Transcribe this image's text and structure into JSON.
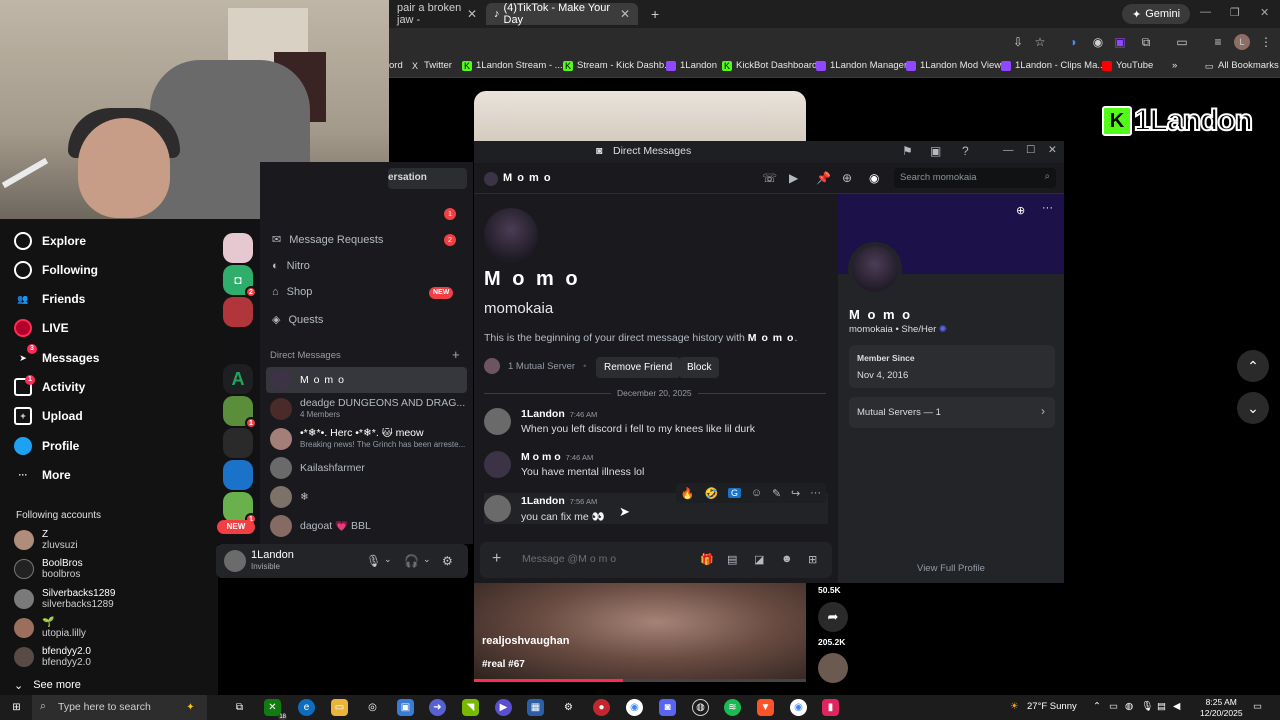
{
  "browser": {
    "tabs": [
      {
        "label": "pair a broken jaw -",
        "close": "✕"
      },
      {
        "label": "(4)TikTok - Make Your Day",
        "close": "✕"
      }
    ],
    "new_tab": "+",
    "gemini": "Gemini",
    "bookmarks": [
      {
        "label": "ord",
        "color": "#2b2b2b"
      },
      {
        "label": "Twitter",
        "icon": "x-icon"
      },
      {
        "label": "1Landon Stream - ...",
        "color": "#53fc18"
      },
      {
        "label": "Stream - Kick Dashb...",
        "color": "#53fc18"
      },
      {
        "label": "1Landon",
        "color": "#9146ff"
      },
      {
        "label": "KickBot Dashboard",
        "color": "#53fc18"
      },
      {
        "label": "1Landon Manager",
        "color": "#9146ff"
      },
      {
        "label": "1Landon Mod View",
        "color": "#9146ff"
      },
      {
        "label": "1Landon - Clips Ma...",
        "color": "#9146ff"
      },
      {
        "label": "YouTube",
        "color": "#ff0000"
      }
    ],
    "all_bookmarks": "All Bookmarks"
  },
  "tiktok_nav": {
    "items": [
      {
        "label": "Explore",
        "glyph": "⊘"
      },
      {
        "label": "Following",
        "glyph": "⦾"
      },
      {
        "label": "Friends",
        "glyph": "👥"
      },
      {
        "label": "LIVE",
        "glyph": "●"
      },
      {
        "label": "Messages",
        "glyph": "➤",
        "badge": "3"
      },
      {
        "label": "Activity",
        "glyph": "▤",
        "badge": "1"
      },
      {
        "label": "Upload",
        "glyph": "+"
      },
      {
        "label": "Profile",
        "glyph": "●"
      },
      {
        "label": "More",
        "glyph": "···"
      }
    ],
    "following_title": "Following accounts",
    "accounts": [
      {
        "user": "Z",
        "name": "zluvsuzi"
      },
      {
        "user": "BoolBros",
        "name": "boolbros"
      },
      {
        "user": "Silverbacks1289",
        "name": "silverbacks1289"
      },
      {
        "user": "🌱",
        "name": "utopia.lilly"
      },
      {
        "user": "bfendyy2.0",
        "name": "bfendyy2.0"
      }
    ],
    "see_more": "See more"
  },
  "discord": {
    "window_title": "Direct Messages",
    "convo_label": "ersation",
    "dm_nav": [
      {
        "label": "Message Requests",
        "badge": "2"
      },
      {
        "label": "Nitro"
      },
      {
        "label": "Shop",
        "badge_new": "NEW"
      },
      {
        "label": "Quests"
      }
    ],
    "top_badge": "1",
    "dm_header": "Direct Messages",
    "dm_plus": "+",
    "dms": [
      {
        "name": "M o m o",
        "sub": ""
      },
      {
        "name": "deadge DUNGEONS AND DRAG...",
        "sub": "4 Members"
      },
      {
        "name": "•*❄*•. Herc •*❄*. 🐱 meow",
        "sub": "Breaking news! The Grinch has been arreste..."
      },
      {
        "name": "Kailashfarmer",
        "sub": ""
      },
      {
        "name": "❄",
        "sub": ""
      },
      {
        "name": "dagoat 💗 BBL",
        "sub": ""
      }
    ],
    "rail_badges": [
      "2",
      "1",
      "1",
      "1"
    ],
    "rail_letter": "A",
    "new_pill": "NEW",
    "user": {
      "name": "1Landon",
      "status": "Invisible"
    },
    "chat_header": "M o m o",
    "search_placeholder": "Search momokaia",
    "intro": {
      "display_name": "M o m o",
      "username": "momokaia",
      "begin_text": "This is the beginning of your direct message history with",
      "begin_name": "M o m o",
      "mutual": "1 Mutual Server",
      "remove_friend": "Remove Friend",
      "block": "Block"
    },
    "date_divider": "December 20, 2025",
    "messages": [
      {
        "author": "1Landon",
        "time": "7:46 AM",
        "text": "When you left discord i fell to my knees like lil durk"
      },
      {
        "author": "M o m o",
        "time": "7:46 AM",
        "text": "You have mental illness lol"
      },
      {
        "author": "1Landon",
        "time": "7:56 AM",
        "text": "you can fix me 👀"
      }
    ],
    "reactions": [
      "🔥",
      "🤣",
      "G",
      "☺",
      "✎",
      "↪",
      "···"
    ],
    "composer_placeholder": "Message @M o m o",
    "profile": {
      "display_name": "M o m o",
      "meta": "momokaia • She/Her",
      "member_since_label": "Member Since",
      "member_since": "Nov 4, 2016",
      "mutual_servers": "Mutual Servers — 1",
      "view_full": "View Full Profile"
    }
  },
  "tiktok_video": {
    "username": "realjoshvaughan",
    "tag": "#real #67",
    "shares": "50.5K",
    "likes": "205.2K",
    "progress": 0.45
  },
  "overlay_logo": {
    "k": "K",
    "text": "1Landon"
  },
  "taskbar": {
    "search_placeholder": "Type here to search",
    "app_badge": "18",
    "weather": "27°F  Sunny",
    "time": "8:25 AM",
    "date": "12/20/2025"
  },
  "colors": {
    "accent_red": "#f23f43",
    "tiktok_red": "#fe2c55",
    "kick_green": "#53fc18"
  }
}
